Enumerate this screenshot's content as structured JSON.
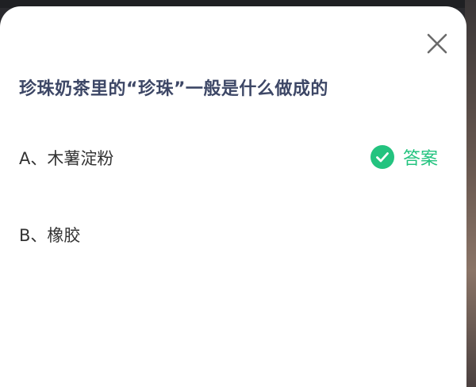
{
  "question": {
    "text": "珍珠奶茶里的“珍珠”一般是什么做成的"
  },
  "options": [
    {
      "text": "A、木薯淀粉",
      "is_answer": true
    },
    {
      "text": "B、橡胶",
      "is_answer": false
    }
  ],
  "answer_tag": {
    "label": "答案",
    "icon": "check-circle-icon"
  },
  "close_button": {
    "icon": "close-icon"
  },
  "colors": {
    "question_text": "#3d4766",
    "option_text": "#333333",
    "answer_accent": "#23c37f",
    "sheet_background": "#ffffff"
  }
}
